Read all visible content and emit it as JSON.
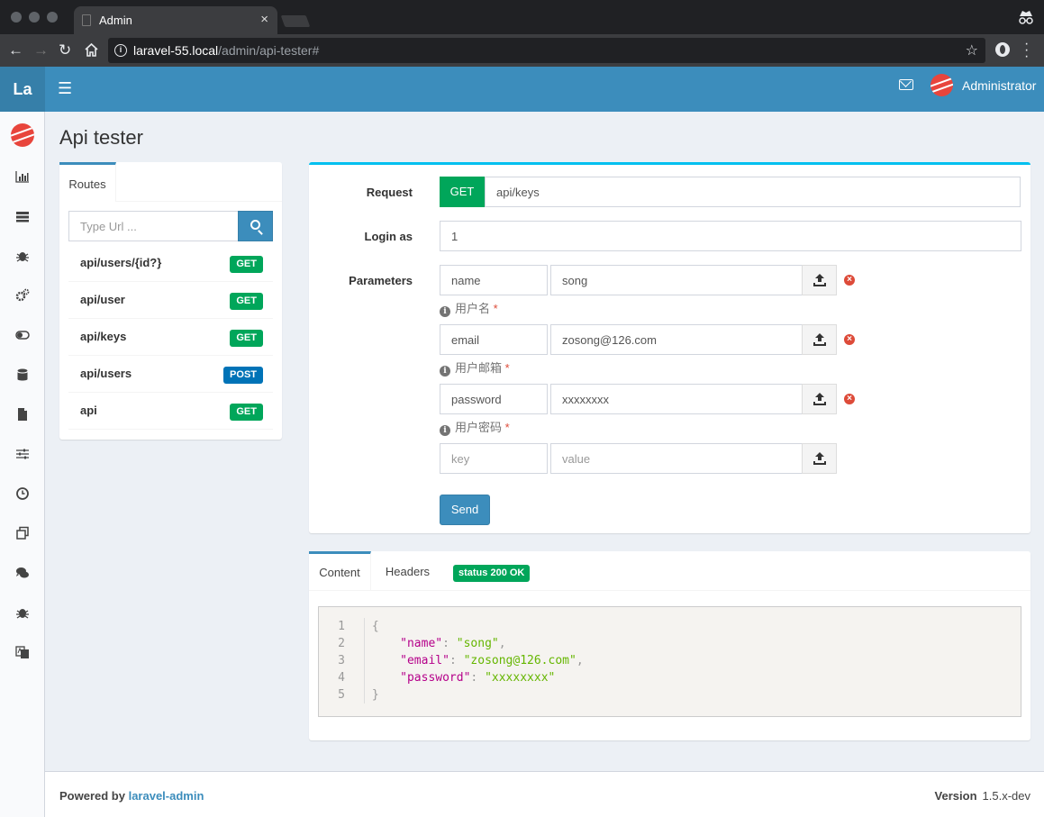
{
  "browser": {
    "tab_title": "Admin",
    "tab_close": "×",
    "url_host": "laravel-55.local",
    "url_path": "/admin/api-tester#"
  },
  "header": {
    "logo": "La",
    "username": "Administrator"
  },
  "page": {
    "title": "Api tester"
  },
  "routes": {
    "tab_label": "Routes",
    "search_placeholder": "Type Url ...",
    "items": [
      {
        "path": "api/users/{id?}",
        "method": "GET"
      },
      {
        "path": "api/user",
        "method": "GET"
      },
      {
        "path": "api/keys",
        "method": "GET"
      },
      {
        "path": "api/users",
        "method": "POST"
      },
      {
        "path": "api",
        "method": "GET"
      }
    ]
  },
  "request": {
    "request_label": "Request",
    "method": "GET",
    "uri": "api/keys",
    "login_label": "Login as",
    "login_value": "1",
    "params_label": "Parameters",
    "params": [
      {
        "key": "name",
        "value": "song",
        "help": "用户名",
        "required_mark": "*"
      },
      {
        "key": "email",
        "value": "zosong@126.com",
        "help": "用户邮箱",
        "required_mark": "*"
      },
      {
        "key": "password",
        "value": "xxxxxxxx",
        "help": "用户密码",
        "required_mark": "*"
      }
    ],
    "new_param": {
      "key_placeholder": "key",
      "value_placeholder": "value"
    },
    "send_label": "Send"
  },
  "response": {
    "tab_content": "Content",
    "tab_headers": "Headers",
    "status": "status 200  OK",
    "line_numbers": [
      "1",
      "2",
      "3",
      "4",
      "5"
    ],
    "json": {
      "open": "{",
      "close": "}",
      "fields": [
        {
          "key": "\"name\"",
          "value": "\"song\"",
          "sep": ","
        },
        {
          "key": "\"email\"",
          "value": "\"zosong@126.com\"",
          "sep": ","
        },
        {
          "key": "\"password\"",
          "value": "\"xxxxxxxx\"",
          "sep": ""
        }
      ]
    }
  },
  "footer": {
    "powered_by": "Powered by",
    "link": "laravel-admin",
    "version_label": "Version",
    "version": "1.5.x-dev"
  },
  "colors": {
    "primary": "#3c8dbc",
    "success": "#00a65a",
    "info": "#00c0ef",
    "danger": "#dd4b39",
    "post_blue": "#0073b7"
  }
}
